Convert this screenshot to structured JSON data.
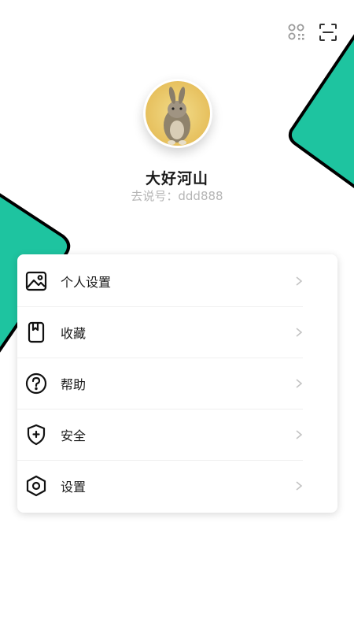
{
  "profile": {
    "name": "大好河山",
    "id_text": "去说号：ddd888"
  },
  "header": {
    "icons": [
      "qr-code-icon",
      "scan-icon"
    ]
  },
  "menu": {
    "items": [
      {
        "label": "个人设置",
        "icon": "image-icon"
      },
      {
        "label": "收藏",
        "icon": "bookmark-icon"
      },
      {
        "label": "帮助",
        "icon": "help-icon"
      },
      {
        "label": "安全",
        "icon": "shield-icon"
      },
      {
        "label": "设置",
        "icon": "settings-hexagon-icon"
      }
    ]
  },
  "colors": {
    "accent": "#1ec4a0",
    "outline": "#000000",
    "muted_text": "#b5b5b5",
    "chevron": "#c4c4c4"
  }
}
